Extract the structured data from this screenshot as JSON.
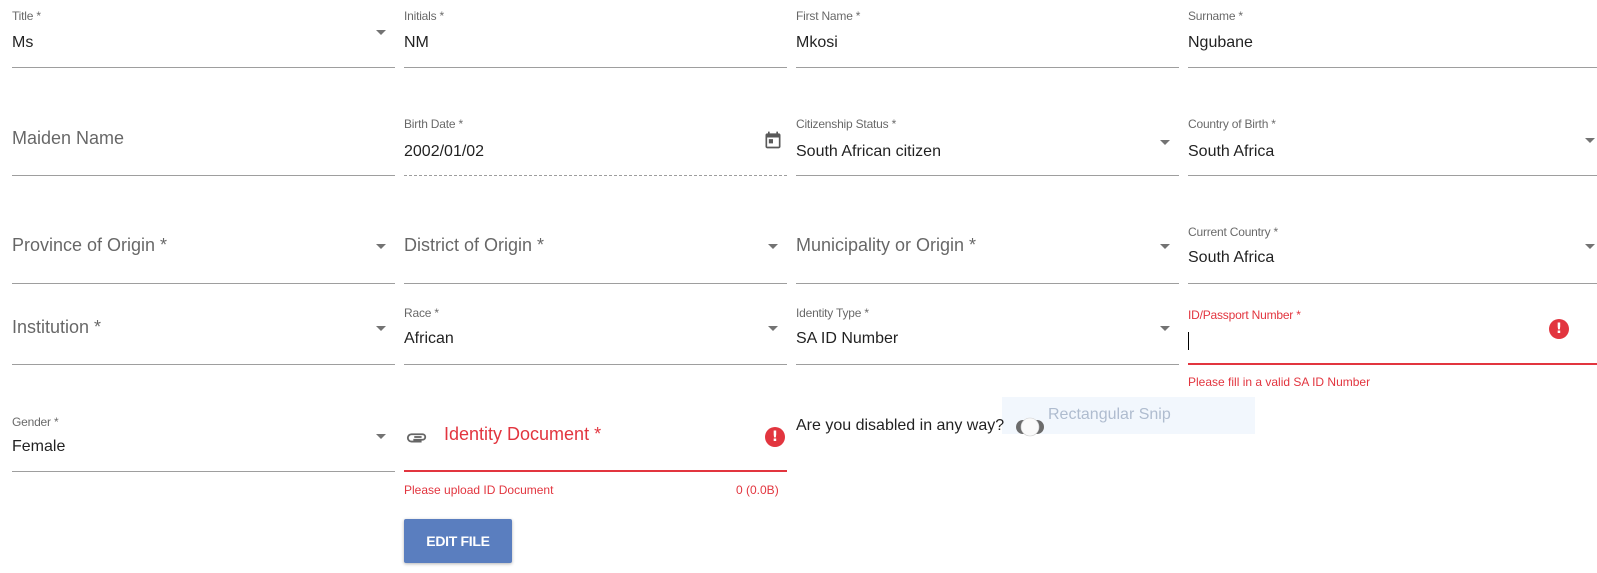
{
  "fields": {
    "title": {
      "label": "Title *",
      "value": "Ms"
    },
    "initials": {
      "label": "Initials *",
      "value": "NM"
    },
    "first_name": {
      "label": "First Name *",
      "value": "Mkosi"
    },
    "surname": {
      "label": "Surname *",
      "value": "Ngubane"
    },
    "maiden_name": {
      "label": "Maiden Name"
    },
    "birth_date": {
      "label": "Birth Date *",
      "value": "2002/01/02"
    },
    "citizenship_status": {
      "label": "Citizenship Status *",
      "value": "South African citizen"
    },
    "country_of_birth": {
      "label": "Country of Birth *",
      "value": "South Africa"
    },
    "province_of_origin": {
      "label": "Province of Origin *"
    },
    "district_of_origin": {
      "label": "District of Origin *"
    },
    "municipality_of_origin": {
      "label": "Municipality or Origin *"
    },
    "current_country": {
      "label": "Current Country *",
      "value": "South Africa"
    },
    "institution": {
      "label": "Institution *"
    },
    "race": {
      "label": "Race *",
      "value": "African"
    },
    "identity_type": {
      "label": "Identity Type *",
      "value": "SA ID Number"
    },
    "id_passport_number": {
      "label": "ID/Passport Number *",
      "value": "",
      "error": "Please fill in a valid SA ID Number"
    },
    "gender": {
      "label": "Gender *",
      "value": "Female"
    },
    "identity_document": {
      "label": "Identity Document *",
      "error": "Please upload ID Document",
      "size": "0 (0.0B)"
    }
  },
  "disabled_question": "Are you disabled in any way?",
  "edit_file_label": "EDIT FILE",
  "overlay": {
    "text": "Rectangular Snip"
  },
  "colors": {
    "error": "#e2353f",
    "button": "#5a7ebf",
    "underline": "#9e9e9e"
  }
}
